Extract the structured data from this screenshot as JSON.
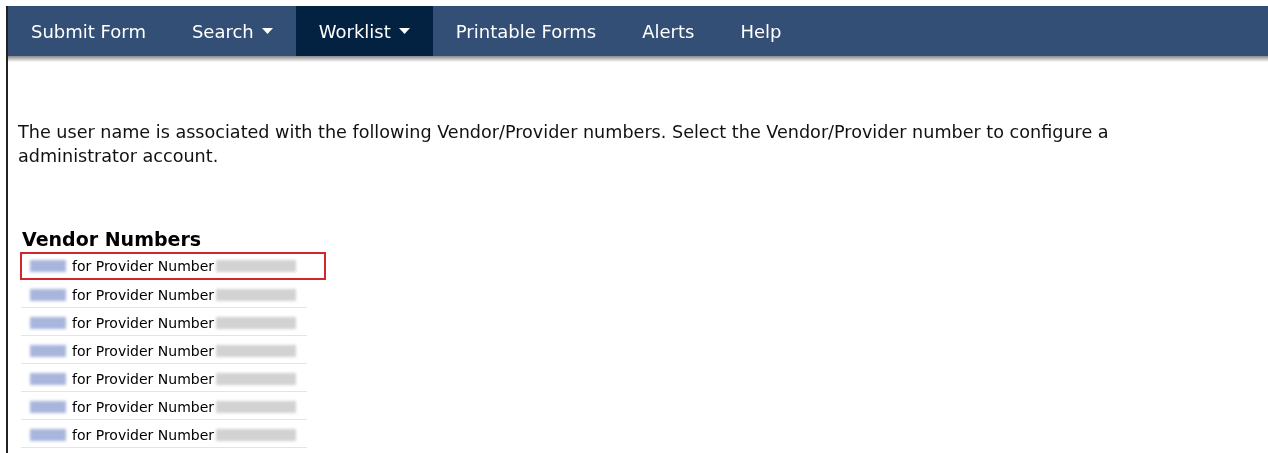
{
  "nav": [
    {
      "label": "Submit Form",
      "dropdown": false,
      "selected": false
    },
    {
      "label": "Search",
      "dropdown": true,
      "selected": false
    },
    {
      "label": "Worklist",
      "dropdown": true,
      "selected": true
    },
    {
      "label": "Printable Forms",
      "dropdown": false,
      "selected": false
    },
    {
      "label": "Alerts",
      "dropdown": false,
      "selected": false
    },
    {
      "label": "Help",
      "dropdown": false,
      "selected": false
    }
  ],
  "intro": "The user name is associated with the following Vendor/Provider numbers. Select the Vendor/Provider number to configure a administrator account.",
  "vendor_numbers": {
    "heading": "Vendor Numbers",
    "rows": [
      {
        "text": "for Provider Number",
        "highlighted": true
      },
      {
        "text": "for Provider Number",
        "highlighted": false
      },
      {
        "text": "for Provider Number",
        "highlighted": false
      },
      {
        "text": "for Provider Number",
        "highlighted": false
      },
      {
        "text": "for Provider Number",
        "highlighted": false
      },
      {
        "text": "for Provider Number",
        "highlighted": false
      },
      {
        "text": "for Provider Number",
        "highlighted": false
      }
    ]
  }
}
